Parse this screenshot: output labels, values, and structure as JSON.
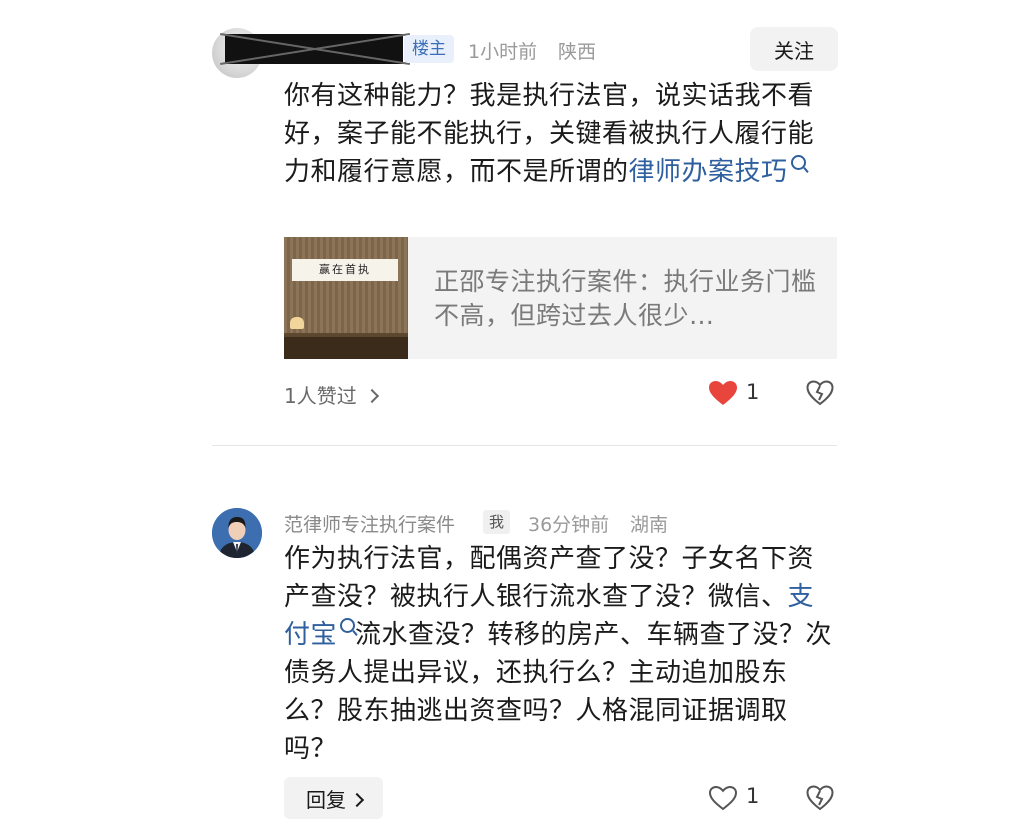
{
  "comment1": {
    "author_tag": "楼主",
    "time": "1小时前",
    "location": "陕西",
    "follow_label": "关注",
    "text_before": "你有这种能力？我是执行法官，说实话我不看好，案子能不能执行，关键看被执行人履行能力和履行意愿，而不是所谓的",
    "link_text": "律师办案技巧",
    "link_card": {
      "image_text": "赢在首执",
      "title": "正邵专注执行案件：执行业务门槛不高，但跨过去人很少…"
    },
    "liked_by": "1人赞过",
    "like_count": "1"
  },
  "comment2": {
    "author": "范律师专注执行案件",
    "self_tag": "我",
    "time": "36分钟前",
    "location": "湖南",
    "text_before": "作为执行法官，配偶资产查了没？子女名下资产查没？被执行人银行流水查了没？微信、",
    "link_text": "支付宝",
    "text_after": "流水查没？转移的房产、车辆查了没？次债务人提出异议，还执行么？主动追加股东么？股东抽逃出资查吗？人格混同证据调取吗？",
    "reply_label": "回复",
    "like_count": "1"
  },
  "colors": {
    "link": "#2f5f9e",
    "heart_liked": "#e8453c",
    "tag_owner_bg": "#e9f0fb"
  }
}
